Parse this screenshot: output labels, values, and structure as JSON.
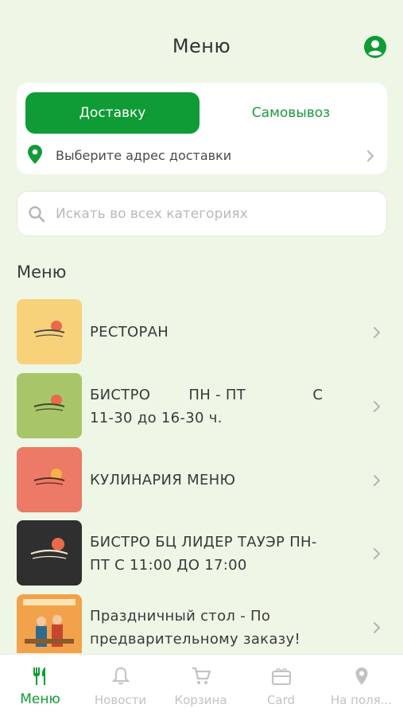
{
  "header": {
    "title": "Меню"
  },
  "delivery": {
    "tab_delivery": "Доставку",
    "tab_pickup": "Самовывоз",
    "address_prompt": "Выберите адрес доставки"
  },
  "search": {
    "placeholder": "Искать во всех категориях",
    "value": ""
  },
  "section": {
    "title": "Меню"
  },
  "categories": [
    {
      "label": "РЕСТОРАН",
      "thumb_color": "#f7d27a"
    },
    {
      "label": "БИСТРО        ПН - ПТ              С\n11-30 до 16-30 ч.",
      "thumb_color": "#a9c56a"
    },
    {
      "label": "КУЛИНАРИЯ МЕНЮ",
      "thumb_color": "#ec7a66"
    },
    {
      "label": "БИСТРО БЦ ЛИДЕР ТАУЭР ПН-\nПТ С 11:00 ДО 17:00",
      "thumb_color": "#2f2f2f"
    },
    {
      "label": "Праздничный стол - По\nпредварительному заказу!",
      "thumb_color": "#f2a24a"
    }
  ],
  "tabbar": {
    "items": [
      {
        "label": "Меню",
        "icon": "fork-knife-icon"
      },
      {
        "label": "Новости",
        "icon": "bell-icon"
      },
      {
        "label": "Корзина",
        "icon": "cart-icon"
      },
      {
        "label": "Card",
        "icon": "gift-card-icon"
      },
      {
        "label": "На поля...",
        "icon": "map-pin-icon"
      }
    ]
  },
  "colors": {
    "accent": "#0f9b35",
    "background": "#eef7e6",
    "inactive": "#c2c2c2"
  }
}
